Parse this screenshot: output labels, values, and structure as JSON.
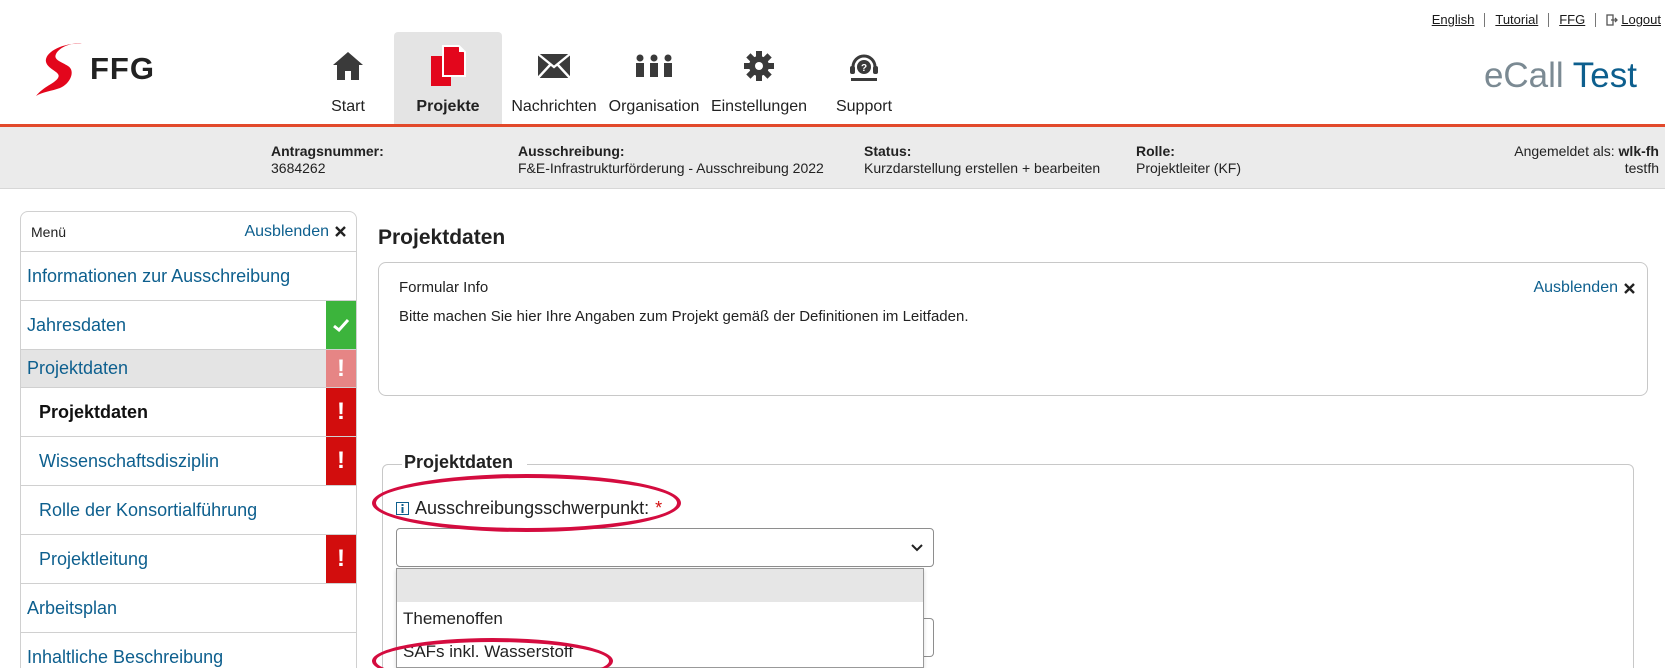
{
  "top_links": {
    "english": "English",
    "tutorial": "Tutorial",
    "ffg": "FFG",
    "logout": "Logout"
  },
  "logo_text": "FFG",
  "brand": {
    "ecall": "eCall",
    "test": "Test"
  },
  "nav": [
    {
      "label": "Start",
      "icon": "home-icon"
    },
    {
      "label": "Projekte",
      "icon": "documents-icon",
      "active": true
    },
    {
      "label": "Nachrichten",
      "icon": "envelope-icon"
    },
    {
      "label": "Organisation",
      "icon": "people-icon"
    },
    {
      "label": "Einstellungen",
      "icon": "gear-icon"
    },
    {
      "label": "Support",
      "icon": "headset-icon"
    }
  ],
  "info_bar": {
    "antrag_label": "Antragsnummer:",
    "antrag_value": "3684262",
    "ausschreibung_label": "Ausschreibung:",
    "ausschreibung_value": "F&E-Infrastrukturförderung - Ausschreibung 2022",
    "status_label": "Status:",
    "status_value": "Kurzdarstellung erstellen + bearbeiten",
    "rolle_label": "Rolle:",
    "rolle_value": "Projektleiter (KF)",
    "login_label": "Angemeldet als:",
    "login_user": "wlk-fh",
    "login_org": "testfh"
  },
  "sidebar": {
    "title": "Menü",
    "hide": "Ausblenden",
    "items": [
      {
        "label": "Informationen zur Ausschreibung",
        "status": "none"
      },
      {
        "label": "Jahresdaten",
        "status": "ok"
      },
      {
        "label": "Projektdaten",
        "status": "warn"
      },
      {
        "label": "Projektdaten",
        "status": "error"
      },
      {
        "label": "Wissenschaftsdisziplin",
        "status": "error"
      },
      {
        "label": "Rolle der Konsortialführung",
        "status": "none"
      },
      {
        "label": "Projektleitung",
        "status": "error"
      },
      {
        "label": "Arbeitsplan",
        "status": "none"
      },
      {
        "label": "Inhaltliche Beschreibung",
        "status": "none"
      }
    ]
  },
  "main": {
    "title": "Projektdaten",
    "info_box": {
      "title": "Formular Info",
      "hide": "Ausblenden",
      "text": "Bitte machen Sie hier Ihre Angaben zum Projekt gemäß der Definitionen im Leitfaden."
    },
    "section_title": "Projektdaten",
    "field_label": "Ausschreibungsschwerpunkt:",
    "required_mark": "*",
    "select_value": "",
    "options": [
      "",
      "Themenoffen",
      "SAFs inkl. Wasserstoff"
    ]
  },
  "colors": {
    "accent_red": "#e2492b",
    "link_blue": "#0d5f8e",
    "ok_green": "#3cb43c",
    "error_red": "#d20d0d",
    "highlight_circle": "#d40c3f"
  }
}
